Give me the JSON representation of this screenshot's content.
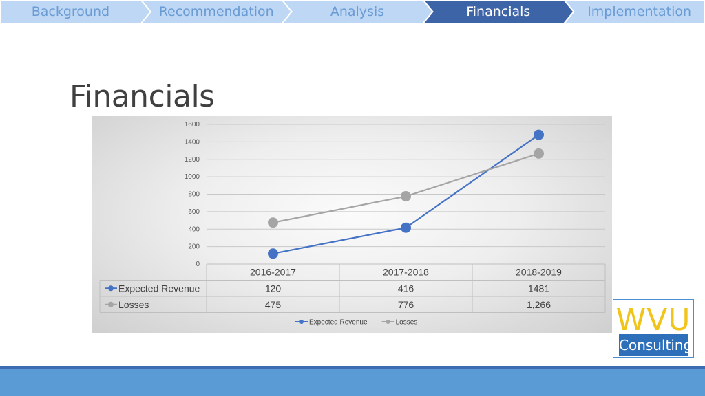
{
  "nav": {
    "steps": [
      {
        "label": "Background",
        "active": false
      },
      {
        "label": "Recommendation",
        "active": false
      },
      {
        "label": "Analysis",
        "active": false
      },
      {
        "label": "Financials",
        "active": true
      },
      {
        "label": "Implementation",
        "active": false
      }
    ],
    "colors": {
      "inactive_fill": "#bdd7f5",
      "inactive_text": "#6a9bd3",
      "active_fill": "#3e64a8",
      "active_text": "#ffffff"
    }
  },
  "page": {
    "title": "Financials"
  },
  "chart_data": {
    "type": "line",
    "categories": [
      "2016-2017",
      "2017-2018",
      "2018-2019"
    ],
    "series": [
      {
        "name": "Expected Revenue",
        "values": [
          120,
          416,
          1481
        ],
        "display": [
          "120",
          "416",
          "1481"
        ],
        "color": "#4472c4"
      },
      {
        "name": "Losses",
        "values": [
          475,
          776,
          1266
        ],
        "display": [
          "475",
          "776",
          "1,266"
        ],
        "color": "#a5a5a5"
      }
    ],
    "yticks": [
      0,
      200,
      400,
      600,
      800,
      1000,
      1200,
      1400,
      1600
    ],
    "ylim": [
      0,
      1600
    ],
    "grid": true,
    "legend": "bottom",
    "data_table": true
  },
  "logo": {
    "top_text": "WVU",
    "bottom_text": "Consulting",
    "top_color": "#f0c419",
    "bottom_bg": "#2e6fba",
    "border": "#4a8fd2"
  }
}
